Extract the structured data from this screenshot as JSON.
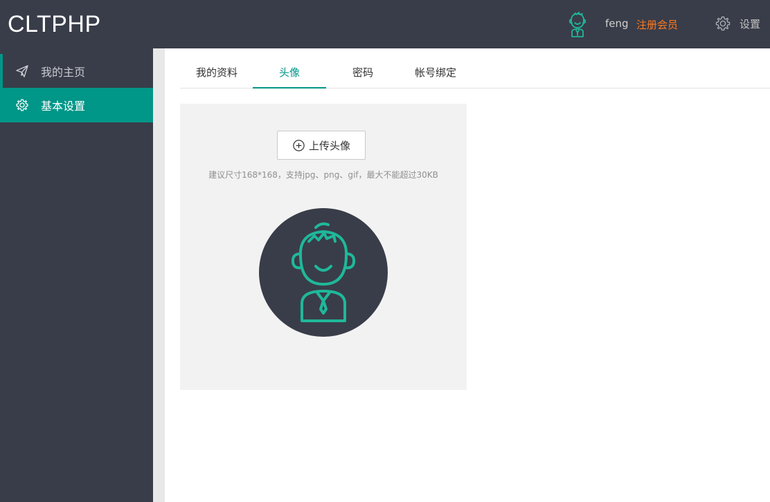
{
  "header": {
    "logo": "CLTPHP",
    "username": "feng",
    "register": "注册会员",
    "settings": "设置",
    "icons": {
      "avatar": "user-avatar-icon",
      "settings": "gear-icon"
    }
  },
  "sidebar": {
    "items": [
      {
        "label": "我的主页",
        "icon": "paper-plane-icon",
        "active": false
      },
      {
        "label": "基本设置",
        "icon": "gear-icon",
        "active": true
      }
    ]
  },
  "tabs": [
    {
      "label": "我的资料",
      "active": false
    },
    {
      "label": "头像",
      "active": true
    },
    {
      "label": "密码",
      "active": false
    },
    {
      "label": "帐号绑定",
      "active": false
    }
  ],
  "upload": {
    "button_label": "上传头像",
    "hint": "建议尺寸168*168，支持jpg、png、gif，最大不能超过30KB"
  },
  "colors": {
    "header_bg": "#393d49",
    "accent": "#009688",
    "register": "#ff7a1f",
    "avatar_line": "#1fb89a"
  }
}
